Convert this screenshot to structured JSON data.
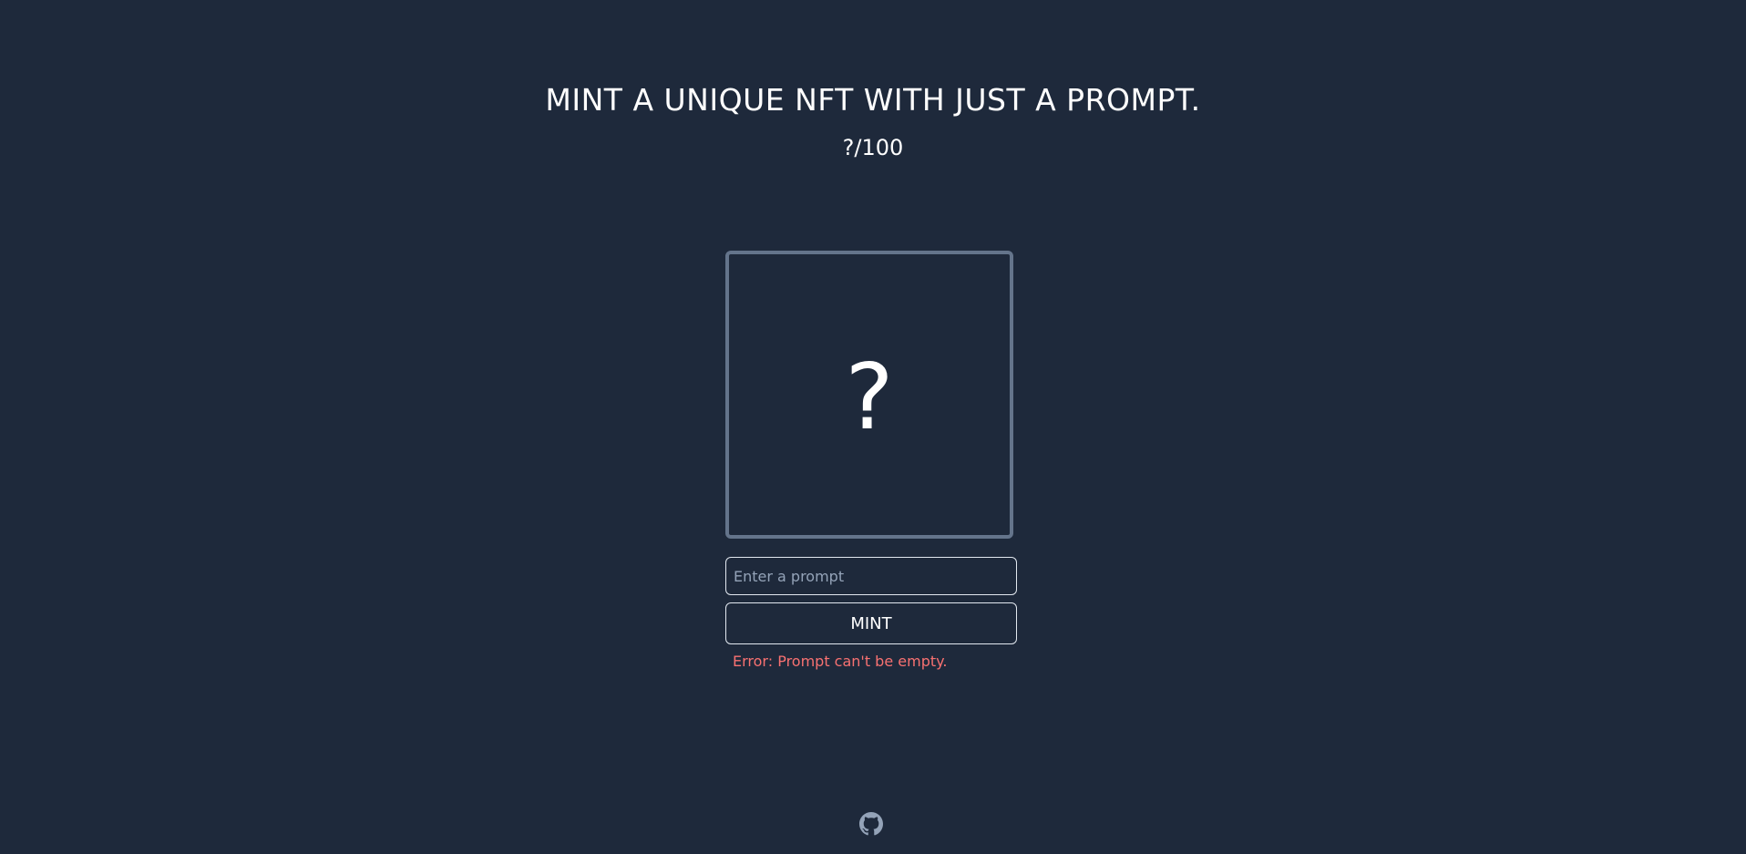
{
  "header": {
    "title": "MINT A UNIQUE NFT WITH JUST A PROMPT.",
    "counter": "?/100"
  },
  "preview": {
    "placeholder": "?",
    "border_color": "#64748b"
  },
  "form": {
    "prompt_placeholder": "Enter a prompt",
    "prompt_value": "",
    "mint_label": "MINT",
    "error": "Error: Prompt can't be empty."
  },
  "footer": {
    "icon": "github-icon"
  },
  "colors": {
    "background": "#1e293b",
    "text": "#ffffff",
    "error": "#f87171",
    "icon": "#94a3b8"
  }
}
